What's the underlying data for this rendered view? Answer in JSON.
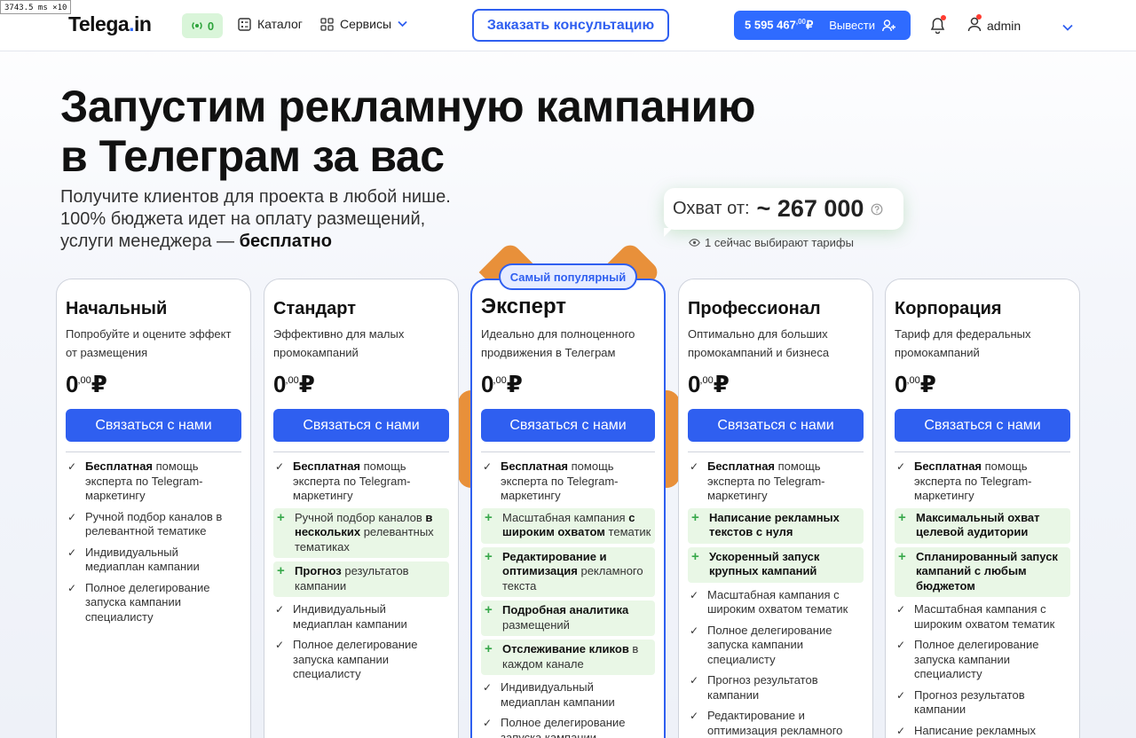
{
  "perf": {
    "label": "3743.5 ms ×10"
  },
  "header": {
    "logo_main": "Telega",
    "logo_dot": ".",
    "logo_tail": "in",
    "online_count": "0",
    "nav_catalog": "Каталог",
    "nav_services": "Сервисы",
    "consult": "Заказать консультацию",
    "balance_amount": "5 595 467",
    "balance_cents": ",00",
    "balance_currency": "₽",
    "withdraw": "Вывести",
    "user_name": "admin"
  },
  "hero": {
    "title_line1": "Запустим рекламную кампанию",
    "title_line2": "в Телеграм за вас",
    "sub_line1": "Получите клиентов для проекта в любой нише.",
    "sub_line2": "100% бюджета идет на оплату размещений,",
    "sub_line3_prefix": "услуги менеджера — ",
    "sub_line3_bold": "бесплатно",
    "reach_label": "Охват от:",
    "reach_value": "~ 267 000",
    "choosing": "1 сейчас выбирают тарифы"
  },
  "popular_badge": "Самый популярный",
  "plans": [
    {
      "name": "Начальный",
      "desc": "Попробуйте и оцените эффект от размещения",
      "price": "0",
      "cents": ",00",
      "currency": "₽",
      "cta": "Связаться с нами"
    },
    {
      "name": "Стандарт",
      "desc": "Эффективно для малых промокампаний",
      "price": "0",
      "cents": ",00",
      "currency": "₽",
      "cta": "Связаться с нами"
    },
    {
      "name": "Эксперт",
      "desc": "Идеально для полноценного продвижения в Телеграм",
      "price": "0",
      "cents": ",00",
      "currency": "₽",
      "cta": "Связаться с нами"
    },
    {
      "name": "Профессионал",
      "desc": "Оптимально для больших промокампаний и бизнеса",
      "price": "0",
      "cents": ",00",
      "currency": "₽",
      "cta": "Связаться с нами"
    },
    {
      "name": "Корпорация",
      "desc": "Тариф для федеральных промокампаний",
      "price": "0",
      "cents": ",00",
      "currency": "₽",
      "cta": "Связаться с нами"
    }
  ],
  "features": {
    "p0": {
      "f0_b": "Бесплатная",
      "f0_t": " помощь эксперта по Telegram-маркетингу",
      "f1_t": "Ручной подбор каналов в релевантной тематике",
      "f2_t": "Индивидуальный медиаплан кампании",
      "f3_t": "Полное делегирование запуска кампании специалисту"
    },
    "p1": {
      "f0_b": "Бесплатная",
      "f0_t": " помощь эксперта по Telegram-маркетингу",
      "f1_t": "Ручной подбор каналов ",
      "f1_b": "в нескольких",
      "f1_t2": " релевантных тематиках",
      "f2_b": "Прогноз",
      "f2_t": " результатов кампании",
      "f3_t": "Индивидуальный медиаплан кампании",
      "f4_t": "Полное делегирование запуска кампании специалисту"
    },
    "p2": {
      "f0_b": "Бесплатная",
      "f0_t": " помощь эксперта по Telegram-маркетингу",
      "f1_t": "Масштабная кампания ",
      "f1_b": "с широким охватом",
      "f1_t2": " тематик",
      "f2_b": "Редактирование и оптимизация",
      "f2_t": " рекламного текста",
      "f3_b": "Подробная аналитика",
      "f3_t": " размещений",
      "f4_b": "Отслеживание кликов",
      "f4_t": " в каждом канале",
      "f5_t": "Индивидуальный медиаплан кампании",
      "f6_t": "Полное делегирование запуска кампании"
    },
    "p3": {
      "f0_b": "Бесплатная",
      "f0_t": " помощь эксперта по Telegram-маркетингу",
      "f1_b": "Написание рекламных текстов с нуля",
      "f2_b": "Ускоренный запуск крупных кампаний",
      "f3_t": "Масштабная кампания с широким охватом тематик",
      "f4_t": "Полное делегирование запуска кампании специалисту",
      "f5_t": "Прогноз результатов кампании",
      "f6_t": "Редактирование и оптимизация рекламного текста"
    },
    "p4": {
      "f0_b": "Бесплатная",
      "f0_t": " помощь эксперта по Telegram-маркетингу",
      "f1_b": "Максимальный охват целевой аудитории",
      "f2_b": "Спланированный запуск кампаний с любым бюджетом",
      "f3_t": "Масштабная кампания с широким охватом тематик",
      "f4_t": "Полное делегирование запуска кампании специалисту",
      "f5_t": "Прогноз результатов кампании",
      "f6_t": "Написание рекламных текстов с нуля"
    }
  },
  "colors": {
    "accent": "#2f5ff0",
    "plus_bg": "#e9f7e6",
    "plus_mark": "#37a84a",
    "mascot": "#e8903a"
  }
}
